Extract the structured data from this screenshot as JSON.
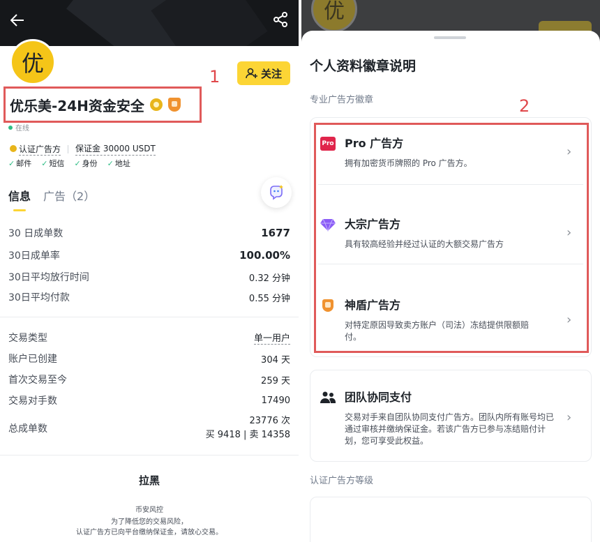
{
  "left": {
    "avatar_text": "优",
    "follow_label": "关注",
    "annotation_1": "1",
    "merchant_name": "优乐美-24H资金安全",
    "online_label": "在线",
    "certified_label": "认证广告方",
    "deposit_label": "保证金 30000 USDT",
    "verifications": [
      "邮件",
      "短信",
      "身份",
      "地址"
    ],
    "tabs": [
      {
        "label": "信息"
      },
      {
        "label": "广告（2）"
      }
    ],
    "stats": [
      {
        "label": "30 日成单数",
        "value": "1677"
      },
      {
        "label": "30日成单率",
        "value": "100.00%"
      },
      {
        "label": "30日平均放行时间",
        "value": "0.32 分钟"
      },
      {
        "label": "30日平均付款",
        "value": "0.55 分钟"
      }
    ],
    "details": [
      {
        "label": "交易类型",
        "value": "单一用户"
      },
      {
        "label": "账户已创建",
        "value": "304 天"
      },
      {
        "label": "首次交易至今",
        "value": "259 天"
      },
      {
        "label": "交易对手数",
        "value": "17490"
      }
    ],
    "total": {
      "label": "总成单数",
      "value": "23776 次",
      "breakdown": "买 9418 | 卖 14358"
    },
    "blacklist_label": "拉黑",
    "risk_title": "币安风控",
    "risk_line1": "为了降低您的交易风险，",
    "risk_line2": "认证广告方已向平台缴纳保证金，请放心交易。"
  },
  "right": {
    "avatar_text": "优",
    "sheet_title": "个人资料徽章说明",
    "section_pro": "专业广告方徽章",
    "annotation_2": "2",
    "badges": [
      {
        "title": "Pro 广告方",
        "desc": "拥有加密货币牌照的 Pro 广告方。",
        "icon": "pro-icon",
        "icon_text": "Pro"
      },
      {
        "title": "大宗广告方",
        "desc": "具有较高经验并经过认证的大额交易广告方",
        "icon": "gem-icon"
      },
      {
        "title": "神盾广告方",
        "desc": "对特定原因导致卖方账户（司法）冻结提供限额赔付。",
        "icon": "shield-icon"
      }
    ],
    "team": {
      "title": "团队协同支付",
      "desc": "交易对手来自团队协同支付广告方。团队内所有账号均已通过审核并缴纳保证金。若该广告方已参与冻结赔付计划，您可享受此权益。",
      "icon": "team-icon"
    },
    "section_level": "认证广告方等级"
  },
  "colors": {
    "brand_yellow": "#fcd535",
    "annotation_red": "#e05a5a",
    "online_green": "#2ebd85"
  }
}
